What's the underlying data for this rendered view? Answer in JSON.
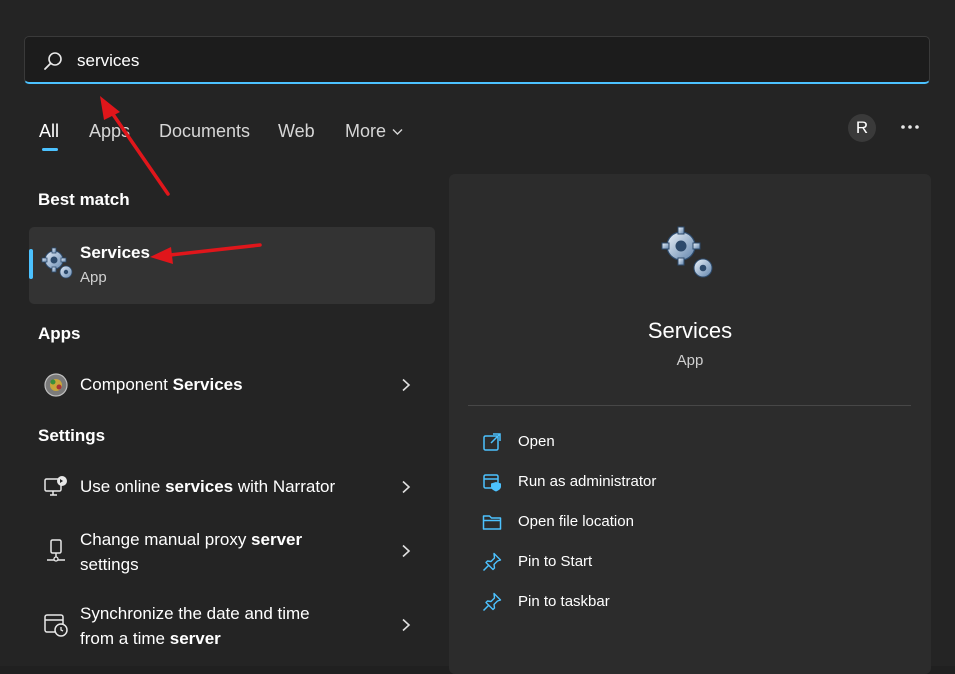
{
  "search": {
    "value": "services",
    "placeholder": ""
  },
  "tabs": [
    {
      "label": "All",
      "active": true
    },
    {
      "label": "Apps"
    },
    {
      "label": "Documents"
    },
    {
      "label": "Web"
    },
    {
      "label": "More"
    }
  ],
  "user": {
    "initial": "R"
  },
  "sections": {
    "best_match": "Best match",
    "apps": "Apps",
    "settings": "Settings"
  },
  "best_match": {
    "name": "Services",
    "type": "App"
  },
  "apps": [
    {
      "prefix": "Component ",
      "highlight": "Services",
      "suffix": ""
    }
  ],
  "settings": [
    {
      "line1_prefix": "Use online ",
      "line1_highlight": "services",
      "line1_suffix": " with Narrator"
    },
    {
      "line1_prefix": "Change manual proxy ",
      "line1_highlight": "server",
      "line1_suffix": "",
      "line2": "settings"
    },
    {
      "line1_prefix": "Synchronize the date and time",
      "line1_highlight": "",
      "line1_suffix": "",
      "line2_prefix": "from a time ",
      "line2_highlight": "server"
    }
  ],
  "preview": {
    "title": "Services",
    "type": "App",
    "actions": [
      {
        "label": "Open",
        "icon": "open-external-icon"
      },
      {
        "label": "Run as administrator",
        "icon": "shield-admin-icon"
      },
      {
        "label": "Open file location",
        "icon": "folder-icon"
      },
      {
        "label": "Pin to Start",
        "icon": "pin-icon"
      },
      {
        "label": "Pin to taskbar",
        "icon": "pin-icon"
      }
    ]
  },
  "colors": {
    "accent": "#4cc2ff",
    "annotation": "#e0161b",
    "background": "#242424"
  }
}
